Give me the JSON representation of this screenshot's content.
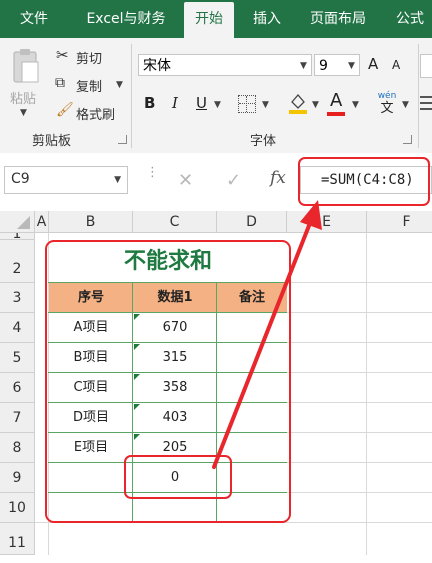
{
  "ribbon_tabs": [
    "文件",
    "Excel与财务",
    "开始",
    "插入",
    "页面布局",
    "公式"
  ],
  "clipboard": {
    "paste": "粘贴",
    "cut": "剪切",
    "copy": "复制",
    "format_painter": "格式刷",
    "group": "剪贴板"
  },
  "font": {
    "name": "宋体",
    "size": "9",
    "group": "字体",
    "grow": "A",
    "shrink": "A",
    "bold": "B",
    "italic": "I",
    "underline": "U",
    "color_letter": "A",
    "phonetic": "wén",
    "phonetic2": "文"
  },
  "name_box": "C9",
  "formula_bar": {
    "fx": "fx",
    "formula": "=SUM(C4:C8)"
  },
  "columns": [
    "A",
    "B",
    "C",
    "D",
    "E",
    "F"
  ],
  "rows": [
    "1",
    "2",
    "3",
    "4",
    "5",
    "6",
    "7",
    "8",
    "9",
    "10",
    "11"
  ],
  "table": {
    "title": "不能求和",
    "headers": [
      "序号",
      "数据1",
      "备注"
    ],
    "items": [
      {
        "name": "A项目",
        "value": "670"
      },
      {
        "name": "B项目",
        "value": "315"
      },
      {
        "name": "C项目",
        "value": "358"
      },
      {
        "name": "D项目",
        "value": "403"
      },
      {
        "name": "E项目",
        "value": "205"
      }
    ],
    "sum": "0"
  },
  "colors": {
    "excel_green": "#227447",
    "title_green": "#1e7a40",
    "header_fill": "#f4b183",
    "annotation_red": "#e8262b"
  }
}
